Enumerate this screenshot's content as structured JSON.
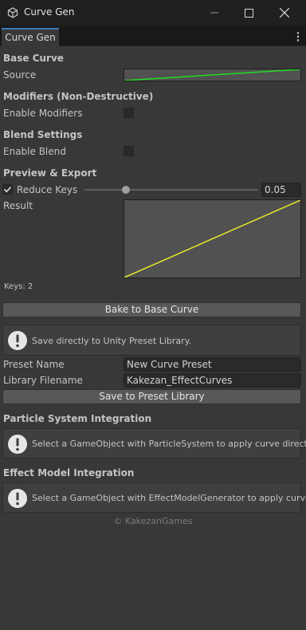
{
  "window": {
    "title": "Curve Gen",
    "tab_label": "Curve Gen"
  },
  "base_curve": {
    "section_title": "Base Curve",
    "source_label": "Source"
  },
  "modifiers": {
    "section_title": "Modifiers (Non-Destructive)",
    "enable_label": "Enable Modifiers",
    "enabled": false
  },
  "blend": {
    "section_title": "Blend Settings",
    "enable_label": "Enable Blend",
    "enabled": false
  },
  "preview": {
    "section_title": "Preview & Export",
    "reduce_keys_label": "Reduce Keys",
    "reduce_keys_checked": true,
    "reduce_value": "0.05",
    "slider_fraction": 0.24,
    "result_label": "Result",
    "keys_text": "Keys: 2",
    "bake_button": "Bake to Base Curve"
  },
  "preset": {
    "help_text": "Save directly to Unity Preset Library.",
    "name_label": "Preset Name",
    "name_value": "New Curve Preset",
    "filename_label": "Library Filename",
    "filename_value": "Kakezan_EffectCurves",
    "save_button": "Save to Preset Library"
  },
  "particle": {
    "section_title": "Particle System Integration",
    "help_text": "Select a GameObject with ParticleSystem to apply curve directly."
  },
  "effect_model": {
    "section_title": "Effect Model Integration",
    "help_text": "Select a GameObject with EffectModelGenerator to apply curve."
  },
  "footer": "© KakezanGames",
  "colors": {
    "source_curve": "#22dd22",
    "result_curve": "#e8e82a",
    "tab_accent": "#3a79bb"
  }
}
